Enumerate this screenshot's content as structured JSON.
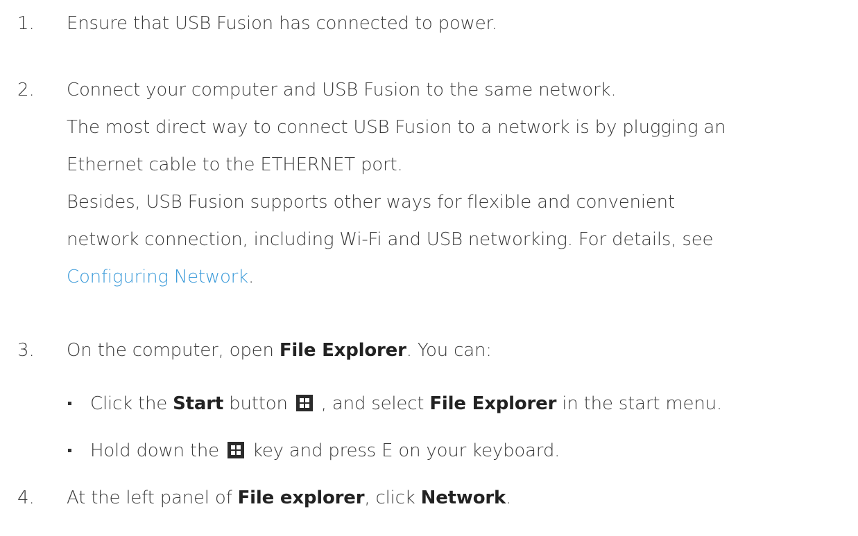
{
  "steps": [
    {
      "number": "1.",
      "text": "Ensure that USB Fusion has connected to power."
    },
    {
      "number": "2.",
      "lines": [
        "Connect your computer and USB Fusion to the same network.",
        "The most direct way to connect USB Fusion to a network is by plugging an",
        "Ethernet cable to the ETHERNET port.",
        "Besides, USB Fusion supports other ways for flexible and convenient",
        "network connection, including Wi-Fi and USB networking. For details, see"
      ],
      "link_text": "Configuring Network",
      "link_suffix": "."
    },
    {
      "number": "3.",
      "prefix": "On the computer, open ",
      "bold": "File Explorer",
      "suffix": ". You can:",
      "bullets": [
        {
          "pre": "Click the ",
          "bold1": "Start",
          "mid1": " button",
          "icon": "windows-logo-icon",
          "mid2": ", and select ",
          "bold2": "File Explorer",
          "post": " in the start menu."
        },
        {
          "pre": "Hold down the",
          "icon": "windows-logo-icon",
          "post": "key and press E on your keyboard."
        }
      ]
    },
    {
      "number": "4.",
      "prefix": "At the left panel of ",
      "bold1": "File explorer",
      "mid": ", click ",
      "bold2": "Network",
      "suffix": "."
    }
  ],
  "colors": {
    "text": "#3a3a3a",
    "link": "#3a9ad9",
    "icon_bg": "#2b2b2b"
  }
}
